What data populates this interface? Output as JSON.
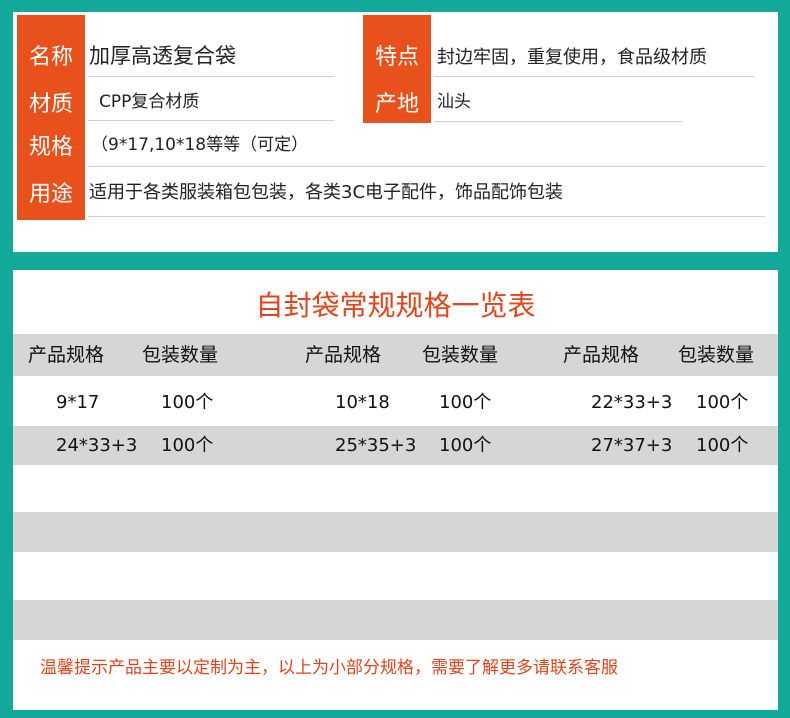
{
  "info": {
    "name_label": "名称",
    "name_value": "加厚高透复合袋",
    "material_label": "材质",
    "material_value": "CPP复合材质",
    "spec_label": "规格",
    "spec_value": "（9*17,10*18等等（可定）",
    "usage_label": "用途",
    "usage_value": "适用于各类服装箱包包装，各类3C电子配件，饰品配饰包装",
    "feature_label": "特点",
    "feature_value": "封边牢固，重复使用，食品级材质",
    "origin_label": "产地",
    "origin_value": "汕头"
  },
  "table": {
    "title": "自封袋常规规格一览表",
    "headers": [
      "产品规格",
      "包装数量",
      "产品规格",
      "包装数量",
      "产品规格",
      "包装数量"
    ],
    "rows": [
      [
        "9*17",
        "100个",
        "10*18",
        "100个",
        "22*33+3",
        "100个"
      ],
      [
        "24*33+3",
        "100个",
        "25*35+3",
        "100个",
        "27*37+3",
        "100个"
      ]
    ]
  },
  "notice": "温馨提示产品主要以定制为主，以上为小部分规格，需要了解更多请联系客服",
  "colors": {
    "background": "#12a89a",
    "accent": "#e8511b",
    "title_red": "#e2441b",
    "band_grey": "#d6d6d6"
  }
}
